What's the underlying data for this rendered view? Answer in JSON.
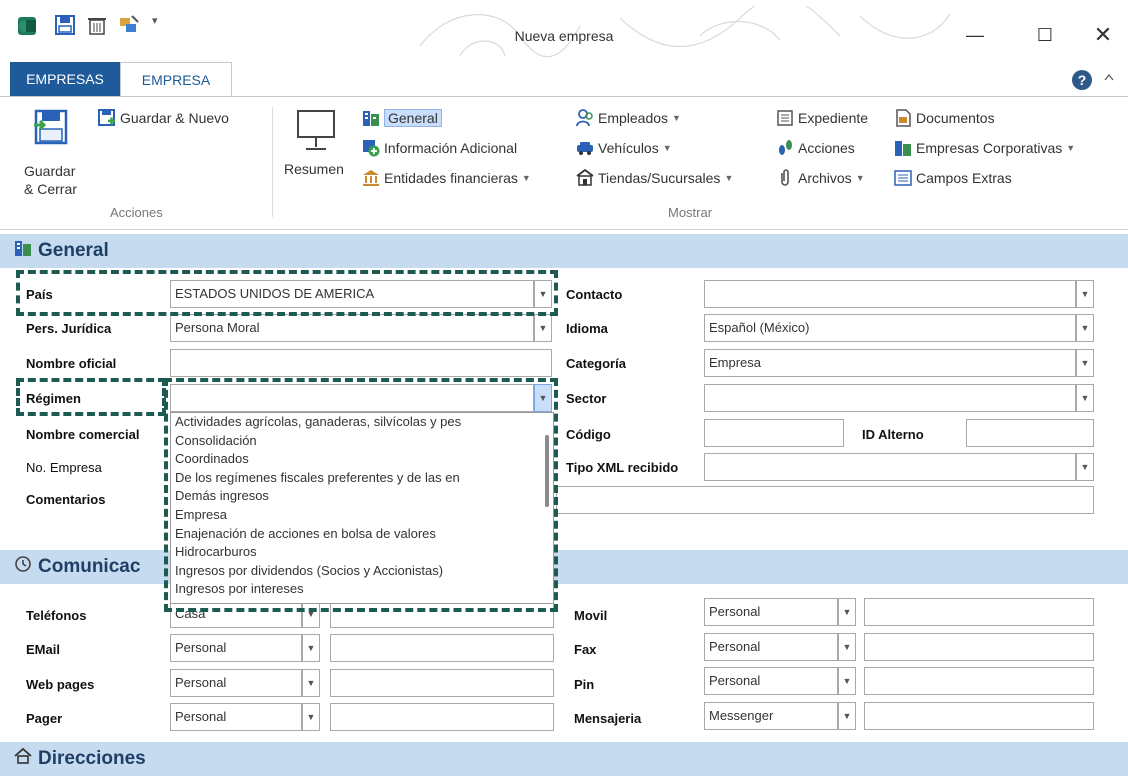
{
  "window": {
    "title": "Nueva empresa",
    "qa_dropdown": "▾",
    "minimize": "—",
    "maximize": "☐",
    "close": "✕"
  },
  "tabs": [
    {
      "label": "EMPRESAS"
    },
    {
      "label": "EMPRESA"
    }
  ],
  "help": "?",
  "ribbon": {
    "acciones": {
      "guardar_cerrar_line1": "Guardar",
      "guardar_cerrar_line2": "& Cerrar",
      "guardar_nuevo": "Guardar & Nuevo",
      "group_label": "Acciones"
    },
    "mostrar": {
      "resumen": "Resumen",
      "general": "General",
      "informacion_adicional": "Información Adicional",
      "entidades_financieras": "Entidades financieras",
      "empleados": "Empleados",
      "vehiculos": "Vehículos",
      "tiendas_sucursales": "Tiendas/Sucursales",
      "expediente": "Expediente",
      "documentos": "Documentos",
      "acciones": "Acciones",
      "empresas_corporativas": "Empresas Corporativas",
      "archivos": "Archivos",
      "campos_extras": "Campos Extras",
      "group_label": "Mostrar"
    }
  },
  "sections": {
    "general": "General",
    "comunicacion": "Comunicac",
    "direcciones": "Direcciones"
  },
  "general_form": {
    "pais_label": "País",
    "pais_value": "ESTADOS UNIDOS DE AMERICA",
    "pers_juridica_label": "Pers. Jurídica",
    "pers_juridica_value": "Persona Moral",
    "nombre_oficial_label": "Nombre oficial",
    "regimen_label": "Régimen",
    "nombre_comercial_label": "Nombre comercial",
    "no_empresa_label": "No. Empresa",
    "comentarios_label": "Comentarios",
    "contacto_label": "Contacto",
    "idioma_label": "Idioma",
    "idioma_value": "Español (México)",
    "categoria_label": "Categoría",
    "categoria_value": "Empresa",
    "sector_label": "Sector",
    "codigo_label": "Código",
    "id_alterno_label": "ID Alterno",
    "tipo_xml_label": "Tipo XML recibido"
  },
  "regimen_options": [
    "Actividades agrícolas, ganaderas, silvícolas y pes",
    "Consolidación",
    "Coordinados",
    "De los regímenes fiscales preferentes y de las en",
    "Demás ingresos",
    "Empresa",
    "Enajenación de acciones en bolsa de valores",
    "Hidrocarburos",
    "Ingresos por dividendos (Socios y Accionistas)",
    "Ingresos por intereses"
  ],
  "comunicacion_form": {
    "telefonos_label": "Teléfonos",
    "telefonos_type": "Casa",
    "email_label": "EMail",
    "email_type": "Personal",
    "webpages_label": "Web pages",
    "webpages_type": "Personal",
    "pager_label": "Pager",
    "pager_type": "Personal",
    "movil_label": "Movil",
    "movil_type": "Personal",
    "fax_label": "Fax",
    "fax_type": "Personal",
    "pin_label": "Pin",
    "pin_type": "Personal",
    "mensajeria_label": "Mensajeria",
    "mensajeria_type": "Messenger"
  },
  "colors": {
    "tab_active_bg": "#1f5a9b",
    "section_bg": "#c7dbf0",
    "dash_highlight": "#1d5a52"
  }
}
